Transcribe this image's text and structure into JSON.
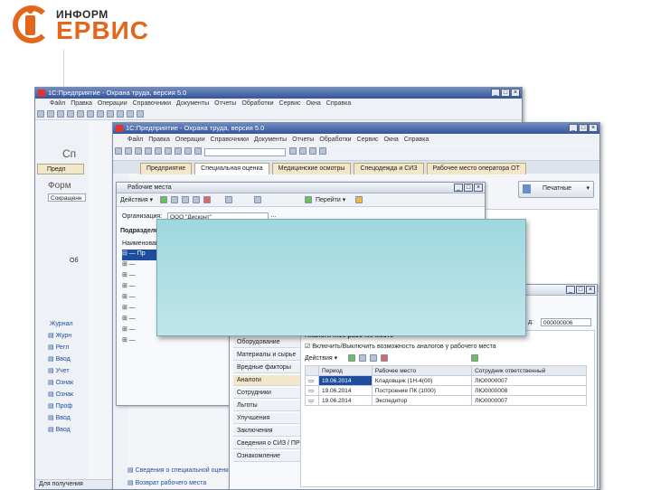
{
  "logo": {
    "line1": "ИНФОРМ",
    "line2": "ЕРВИС"
  },
  "windows": {
    "back": {
      "title": "1С:Предприятие - Охрана труда, версия 5.0",
      "menu": [
        "Файл",
        "Правка",
        "Операции",
        "Справочники",
        "Документы",
        "Отчеты",
        "Обработки",
        "Сервис",
        "Окна",
        "Справка"
      ],
      "left_labels": [
        "Сп",
        "Предп",
        "Форм",
        "Сокращенн",
        "Об",
        "Журнал"
      ],
      "journal_items": [
        "Журн",
        "Регл",
        "Ввод",
        "Учет",
        "Ознак",
        "Ознак",
        "Проф",
        "Ввод",
        "Ввод"
      ],
      "status": "Для получения"
    },
    "front": {
      "title": "1С:Предприятие - Охрана труда, версия 5.0",
      "menu": [
        "Файл",
        "Правка",
        "Операции",
        "Справочники",
        "Документы",
        "Отчеты",
        "Обработки",
        "Сервис",
        "Окна",
        "Справка"
      ],
      "tabs": [
        "Предприятие",
        "Специальная оценка",
        "Медицинские осмотры",
        "Спецодежда и СИЗ",
        "Рабочее место оператора ОТ"
      ],
      "active_tab": 1,
      "printforms_button": "Печатные",
      "code_label": "д:",
      "code_value": "000000006",
      "left_links": [
        "Сведения о специальной оценке",
        "Возврат рабочего места"
      ]
    },
    "workplaces": {
      "title": "Рабочие места",
      "actions_label": "Действия",
      "goto_label": "Перейти",
      "org_label": "Организация:",
      "org_value": "ООО \"Дисконт\"",
      "division_label": "Подразделение",
      "column_name": "Наименование",
      "tree_first": "Пр"
    },
    "analogous": {
      "checkbox_label": "Аналогичное рабочее место",
      "checkbox2_label": "Включить/Выключить возможность аналогов у рабочего места",
      "actions_label": "Действия",
      "side_items": [
        "Оборудование",
        "Материалы и сырье",
        "Вредные факторы",
        "Аналоги",
        "Сотрудники",
        "Льготы",
        "Улучшения",
        "Заключения",
        "Сведения о СИЗ / ПР",
        "Ознакомление"
      ],
      "active_side": 3,
      "columns": [
        "Период",
        "Рабочее место",
        "Сотрудник ответственный"
      ],
      "rows": [
        [
          "19.06.2014",
          "Кладовщик (1Н-4(00)",
          "ЛЮ0000007"
        ],
        [
          "19.06.2014",
          "Построение ПК (1000)",
          "ЛЮ0000008"
        ],
        [
          "19.06.2014",
          "Экспедитор",
          "ЛЮ0000007"
        ]
      ]
    }
  },
  "colors": {
    "accent": "#e4661b",
    "titlebar": "#35549b",
    "popup": "#a8dbe2"
  }
}
